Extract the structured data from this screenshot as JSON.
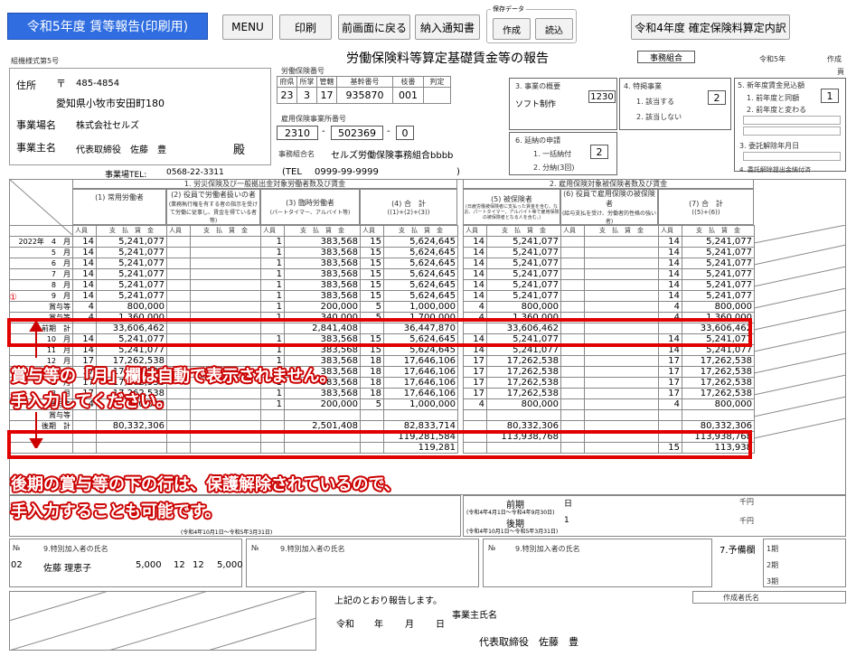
{
  "toolbar": {
    "title": "令和5年度 賃等報告(印刷用)",
    "menu": "MENU",
    "print": "印刷",
    "back": "前画面に戻る",
    "notice": "納入通知書",
    "save_group_label": "保存データ",
    "create": "作成",
    "load": "読込",
    "prev_year": "令和4年度 確定保険料算定内訳"
  },
  "form": {
    "form_no": "組機様式第5号",
    "main_title": "労働保険料等算定基礎賃金等の報告",
    "union_label": "事務組合",
    "era_year": "令和5年",
    "created": "作成",
    "page": "頁",
    "address_label": "住所",
    "postal_mark": "〒",
    "postal": "485-4854",
    "address": "愛知県小牧市安田町180",
    "office_label": "事業場名",
    "office": "株式会社セルズ",
    "owner_label": "事業主名",
    "owner": "代表取締役　佐藤　豊",
    "seal": "殿",
    "tel_label": "事業場TEL:",
    "tel": "0568-22-3311",
    "lin_label": "労働保険番号",
    "lin_headers": [
      "府県",
      "所掌",
      "管轄",
      "基幹番号",
      "枝番",
      "判定"
    ],
    "lin_values": [
      "23",
      "3",
      "17",
      "935870",
      "001",
      ""
    ],
    "emp_label": "雇用保険事業所番号",
    "emp_no1": "2310",
    "emp_no2": "502369",
    "emp_no3": "0",
    "union_name_label": "事務組合名",
    "union_name": "セルズ労働保険事務組合bbbb",
    "union_tel_open": "(TEL",
    "union_tel": "0999-99-9999",
    "union_tel_close": ")"
  },
  "business": {
    "overview_label": "3. 事業の概要",
    "overview": "ソフト制作",
    "overview_code": "1230",
    "special_label": "4. 特掲事業",
    "special_opt1": "1. 該当する",
    "special_opt2": "2. 該当しない",
    "special_value": "2",
    "extension_label": "6. 延納の申請",
    "extension_opt1": "1. 一括納付",
    "extension_opt2": "2. 分納(3回)",
    "extension_value": "2",
    "forecast_label": "5. 新年度賃金見込額",
    "forecast_opt1": "1. 前年度と同額",
    "forecast_opt2": "2. 前年度と変わる",
    "forecast_value": "1",
    "cancel_label": "3. 委託解除年月日",
    "cancel_submit_label": "4. 委託解除提出金納付済"
  },
  "sections": {
    "s1": "1. 労災保険及び一般拠出金対象労働者数及び賃金",
    "s2": "2. 雇用保険対象被保険者数及び賃金",
    "c1": "(1) 常用労働者",
    "c2": "(2) 役員で労働者扱いの者",
    "c2_note": "(業務執行権を有する者の指示を受けて労働に従事し、賃金を得ている者等)",
    "c3": "(3) 臨時労働者",
    "c3_note": "(パートタイマー、アルバイト等)",
    "c4": "(4) 合　計",
    "c4_note": "((1)+(2)+(3))",
    "c5": "(5) 被保険者",
    "c5_note": "(日雇労働被保険者に支払った賃金を含む。なお、パートタイマー、アルバイト等で雇用保険の被保険者となる人を含む。)",
    "c6": "(6) 役員で雇用保険の被保険者",
    "c6_note": "(給与支払を受け、労働者的性格の強い者)",
    "c7": "(7) 合　計",
    "c7_note": "((5)+(6))",
    "people": "人員",
    "wage": "支　払　賃　金",
    "yen": "千円"
  },
  "rows": [
    {
      "label": "2022年　4　月",
      "p1": "14",
      "w1": "5,241,077",
      "p3": "1",
      "w3": "383,568",
      "p4": "15",
      "w4": "5,624,645",
      "p5": "14",
      "w5": "5,241,077",
      "p7": "14",
      "w7": "5,241,077"
    },
    {
      "label": "5　月",
      "p1": "14",
      "w1": "5,241,077",
      "p3": "1",
      "w3": "383,568",
      "p4": "15",
      "w4": "5,624,645",
      "p5": "14",
      "w5": "5,241,077",
      "p7": "14",
      "w7": "5,241,077"
    },
    {
      "label": "6　月",
      "p1": "14",
      "w1": "5,241,077",
      "p3": "1",
      "w3": "383,568",
      "p4": "15",
      "w4": "5,624,645",
      "p5": "14",
      "w5": "5,241,077",
      "p7": "14",
      "w7": "5,241,077"
    },
    {
      "label": "7　月",
      "p1": "14",
      "w1": "5,241,077",
      "p3": "1",
      "w3": "383,568",
      "p4": "15",
      "w4": "5,624,645",
      "p5": "14",
      "w5": "5,241,077",
      "p7": "14",
      "w7": "5,241,077"
    },
    {
      "label": "8　月",
      "p1": "14",
      "w1": "5,241,077",
      "p3": "1",
      "w3": "383,568",
      "p4": "15",
      "w4": "5,624,645",
      "p5": "14",
      "w5": "5,241,077",
      "p7": "14",
      "w7": "5,241,077"
    },
    {
      "label": "9　月",
      "p1": "14",
      "w1": "5,241,077",
      "p3": "1",
      "w3": "383,568",
      "p4": "15",
      "w4": "5,624,645",
      "p5": "14",
      "w5": "5,241,077",
      "p7": "14",
      "w7": "5,241,077"
    },
    {
      "label": "賞与等",
      "p1": "4",
      "w1": "800,000",
      "p3": "1",
      "w3": "200,000",
      "p4": "5",
      "w4": "1,000,000",
      "p5": "4",
      "w5": "800,000",
      "p7": "4",
      "w7": "800,000"
    },
    {
      "label": "賞与等",
      "p1": "4",
      "w1": "1,360,000",
      "p3": "1",
      "w3": "340,000",
      "p4": "5",
      "w4": "1,700,000",
      "p5": "4",
      "w5": "1,360,000",
      "p7": "4",
      "w7": "1,360,000"
    },
    {
      "label": "前期　計",
      "p1": "",
      "w1": "33,606,462",
      "p3": "",
      "w3": "2,841,408",
      "p4": "",
      "w4": "36,447,870",
      "p5": "",
      "w5": "33,606,462",
      "p7": "",
      "w7": "33,606,462"
    },
    {
      "label": "10　月",
      "p1": "14",
      "w1": "5,241,077",
      "p3": "1",
      "w3": "383,568",
      "p4": "15",
      "w4": "5,624,645",
      "p5": "14",
      "w5": "5,241,077",
      "p7": "14",
      "w7": "5,241,077"
    },
    {
      "label": "11　月",
      "p1": "14",
      "w1": "5,241,077",
      "p3": "1",
      "w3": "383,568",
      "p4": "15",
      "w4": "5,624,645",
      "p5": "14",
      "w5": "5,241,077",
      "p7": "14",
      "w7": "5,241,077"
    },
    {
      "label": "12　月",
      "p1": "17",
      "w1": "17,262,538",
      "p3": "1",
      "w3": "383,568",
      "p4": "18",
      "w4": "17,646,106",
      "p5": "17",
      "w5": "17,262,538",
      "p7": "17",
      "w7": "17,262,538"
    },
    {
      "label": "1　月",
      "p1": "17",
      "w1": "17,262,538",
      "p3": "1",
      "w3": "383,568",
      "p4": "18",
      "w4": "17,646,106",
      "p5": "17",
      "w5": "17,262,538",
      "p7": "17",
      "w7": "17,262,538"
    },
    {
      "label": "2　月",
      "p1": "17",
      "w1": "17,262,538",
      "p3": "1",
      "w3": "383,568",
      "p4": "18",
      "w4": "17,646,106",
      "p5": "17",
      "w5": "17,262,538",
      "p7": "17",
      "w7": "17,262,538"
    },
    {
      "label": "3　月",
      "p1": "17",
      "w1": "17,262,538",
      "p3": "1",
      "w3": "383,568",
      "p4": "18",
      "w4": "17,646,106",
      "p5": "17",
      "w5": "17,262,538",
      "p7": "17",
      "w7": "17,262,538"
    },
    {
      "label": "賞与等",
      "p1": "4",
      "w1": "800,000",
      "p3": "1",
      "w3": "200,000",
      "p4": "5",
      "w4": "1,000,000",
      "p5": "4",
      "w5": "800,000",
      "p7": "4",
      "w7": "800,000"
    },
    {
      "label": "賞与等",
      "p1": "",
      "w1": "",
      "p3": "",
      "w3": "",
      "p4": "",
      "w4": "",
      "p5": "",
      "w5": "",
      "p7": "",
      "w7": ""
    },
    {
      "label": "後期　計",
      "p1": "",
      "w1": "80,332,306",
      "p3": "",
      "w3": "2,501,408",
      "p4": "",
      "w4": "82,833,714",
      "p5": "",
      "w5": "80,332,306",
      "p7": "",
      "w7": "80,332,306"
    },
    {
      "label": "",
      "p1": "",
      "w1": "",
      "p3": "",
      "w3": "",
      "p4": "",
      "w4": "119,281,584",
      "p5": "",
      "w5": "113,938,768",
      "p7": "",
      "w7": "113,938,768"
    },
    {
      "label": "",
      "p1": "",
      "w1": "",
      "p3": "",
      "w3": "",
      "p4": "",
      "w4": "119,281",
      "p5": "",
      "w5": "",
      "p7": "15",
      "w7": "113,938"
    }
  ],
  "period": {
    "front": "前期",
    "front_range": "(令和4年4月1日～令和4年9月30日)",
    "back": "後期",
    "back_range": "(令和4年10月1日～令和5年3月31日)",
    "back_range_left": "(令和4年10月1日～令和5年3月31日)",
    "day": "日",
    "one": "1",
    "yen": "千円"
  },
  "special_members": {
    "no_label": "№",
    "name_label": "9.特別加入者の氏名",
    "rows": [
      {
        "no": "02",
        "name": "佐藤 理恵子",
        "amount": "5,000",
        "m1": "12",
        "m2": "12",
        "total": "5,000"
      }
    ],
    "notice_label": "7.予備欄",
    "slots": [
      "1期",
      "2期",
      "3期"
    ],
    "yen": "円"
  },
  "footer": {
    "report_text": "上記のとおり報告します。",
    "era": "令和",
    "year": "年",
    "month": "月",
    "day": "日",
    "owner_label": "事業主氏名",
    "owner": "代表取締役　佐藤　豊",
    "author_label": "作成者氏名"
  },
  "annotations": {
    "circled_1": "①",
    "note1_line1": "賞与等の「月」欄は自動で表示されません。",
    "note1_line2": "手入力してください。",
    "note2_line1": "後期の賞与等の下の行は、保護解除されているので、",
    "note2_line2": "手入力することも可能です。"
  },
  "colors": {
    "title_bg": "#2f6de1",
    "annotation": "#e10000"
  }
}
